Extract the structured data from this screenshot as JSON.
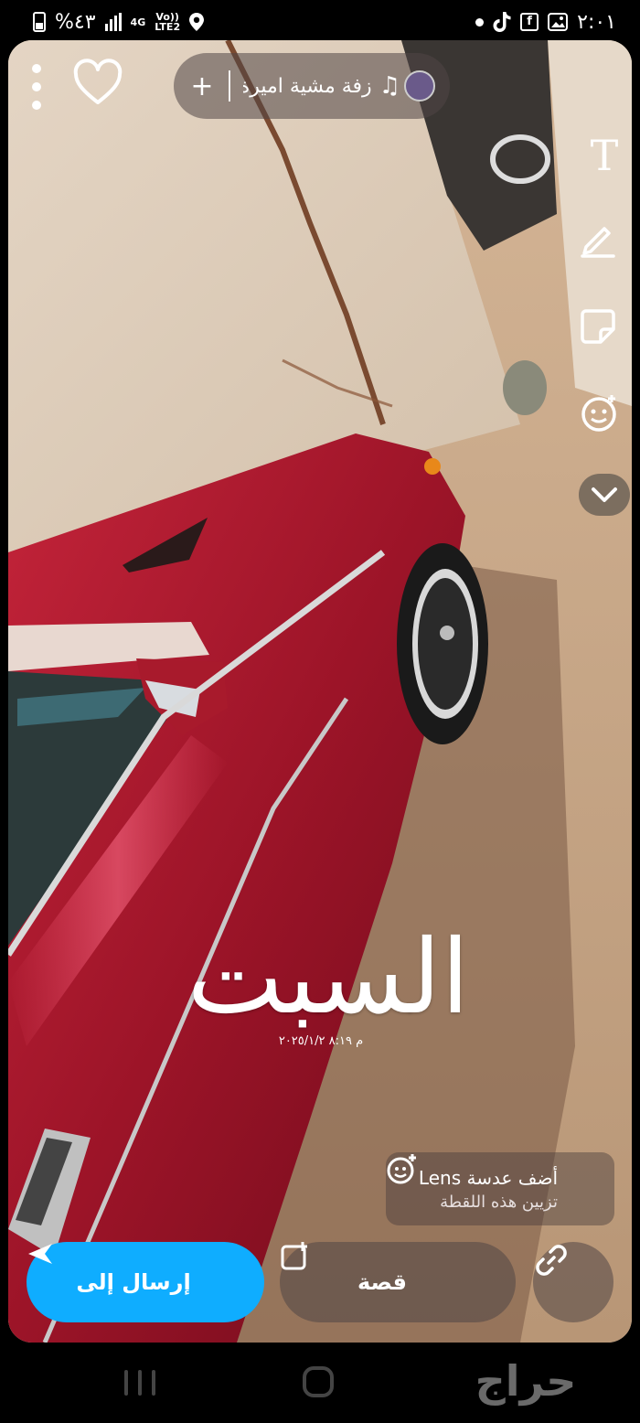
{
  "status_bar": {
    "time": "٢:٠١",
    "battery": "%٤٣",
    "network": "4G",
    "volte": "Vo))",
    "lte": "LTE2"
  },
  "sound": {
    "title": "زفة مشية اميرة - مص..",
    "add_label": "+"
  },
  "tools": {
    "text_label": "T"
  },
  "caption": {
    "day": "السبت",
    "datetime": "م ٨:١٩ ٢٠٢٥/١/٢"
  },
  "lens": {
    "title": "أضف عدسة Lens",
    "subtitle": "تزيين هذه اللقطة"
  },
  "actions": {
    "send_label": "إرسال إلى",
    "story_label": "قصة"
  },
  "watermark": {
    "text": "حراج"
  },
  "colors": {
    "send_blue": "#0fadff",
    "car_red": "#a3162a",
    "wall_beige": "#e2d2bf"
  }
}
